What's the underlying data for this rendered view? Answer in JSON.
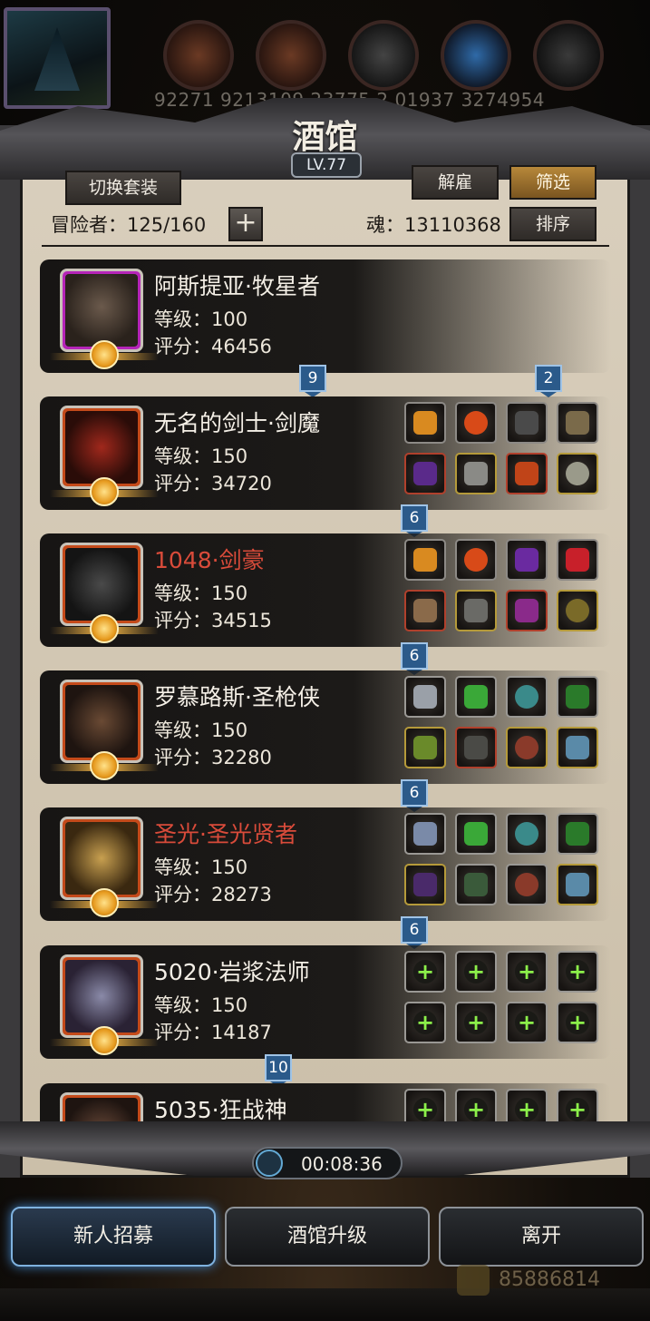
{
  "top_bar": {
    "resource_values": "92271  9213109  23775  2  01937  3274954"
  },
  "panel": {
    "title": "酒馆",
    "level": "LV.77",
    "switch_set_label": "切换套装",
    "dismiss_label": "解雇",
    "filter_label": "筛选",
    "sort_label": "排序",
    "adventurers_label": "冒险者：125/160",
    "add_label": "+",
    "soul_label": "魂：13110368"
  },
  "heroes": [
    {
      "name": "阿斯提亚·牧星者",
      "name_color": "white",
      "level": "等级：100",
      "score": "评分：46456",
      "frame": "purple",
      "equipment": []
    },
    {
      "name": "无名的剑士·剑魔",
      "name_color": "white",
      "level": "等级：150",
      "score": "评分：34720",
      "frame": "red",
      "equipment": [
        "crown-icon",
        "flame-orb-icon",
        "feather-icon",
        "crossed-blades-icon",
        "dark-staff-icon",
        "chest-armor-icon",
        "fire-sword-icon",
        "ring-icon"
      ]
    },
    {
      "name": "1048·剑豪",
      "name_color": "red",
      "level": "等级：150",
      "score": "评分：34515",
      "frame": "red",
      "equipment": [
        "crown-icon",
        "flame-orb-icon",
        "shield-crest-icon",
        "ruby-gem-icon",
        "sword-icon",
        "plate-armor-icon",
        "purple-blade-icon",
        "round-shield-icon"
      ]
    },
    {
      "name": "罗慕路斯·圣枪侠",
      "name_color": "white",
      "level": "等级：150",
      "score": "评分：32280",
      "frame": "red",
      "equipment": [
        "silver-crown-icon",
        "green-helm-icon",
        "stone-icon",
        "green-tome-icon",
        "green-gun-icon",
        "dark-armor-icon",
        "amulet-icon",
        "potion-icon"
      ]
    },
    {
      "name": "圣光·圣光贤者",
      "name_color": "red",
      "level": "等级：150",
      "score": "评分：28273",
      "frame": "red",
      "equipment": [
        "silver-crown-icon",
        "green-helm-icon",
        "stone-icon",
        "green-tome-icon",
        "staff-icon",
        "green-armor-icon",
        "amulet-icon",
        "potion-icon"
      ]
    },
    {
      "name": "5020·岩浆法师",
      "name_color": "white",
      "level": "等级：150",
      "score": "评分：14187",
      "frame": "red",
      "equipment": [
        "plus-icon",
        "plus-icon",
        "plus-icon",
        "plus-icon",
        "plus-icon",
        "plus-icon",
        "plus-icon",
        "plus-icon"
      ]
    },
    {
      "name": "5035·狂战神",
      "name_color": "white",
      "level": "",
      "score": "",
      "frame": "red",
      "equipment": [
        "plus-icon",
        "plus-icon",
        "plus-icon",
        "plus-icon"
      ]
    }
  ],
  "tags": [
    "9",
    "2",
    "6",
    "6",
    "6",
    "6",
    "10"
  ],
  "timer": "00:08:36",
  "bottom": {
    "recruit_label": "新人招募",
    "upgrade_label": "酒馆升级",
    "leave_label": "离开",
    "gold": "85886814"
  },
  "colors": {
    "gold_accent": "#b7883a",
    "red_name": "#d94b3a",
    "tag_blue": "#2b5a8a",
    "plus_green": "#8cf04a"
  }
}
